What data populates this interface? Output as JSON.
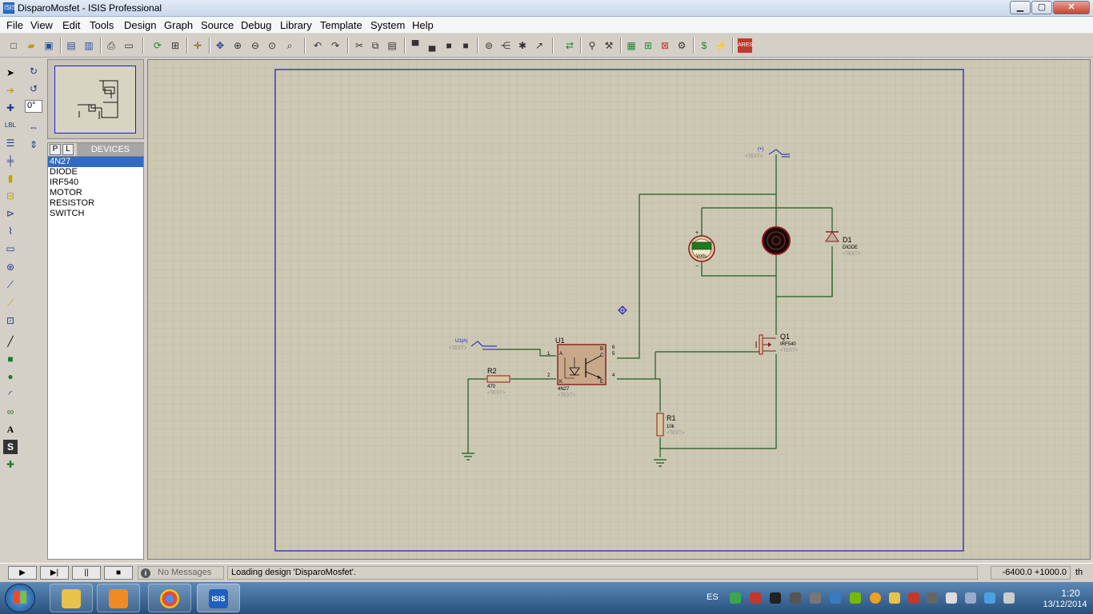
{
  "window": {
    "title": "DisparoMosfet - ISIS Professional",
    "app_icon_text": "ISIS",
    "min_label": "▁",
    "max_label": "▢",
    "close_label": "✕"
  },
  "menu": [
    "File",
    "View",
    "Edit",
    "Tools",
    "Design",
    "Graph",
    "Source",
    "Debug",
    "Library",
    "Template",
    "System",
    "Help"
  ],
  "side_panel": {
    "angle_value": "0°",
    "tab_p": "P",
    "tab_l": "L",
    "devices_title": "DEVICES",
    "devices": [
      "4N27",
      "DIODE",
      "IRF540",
      "MOTOR",
      "RESISTOR",
      "SWITCH"
    ],
    "selected_device": "4N27"
  },
  "schematic": {
    "source_label": "(+)",
    "source_text": "<TEXT>",
    "input_label": "U1(A)",
    "input_text": "<TEXT>",
    "u1_ref": "U1",
    "u1_part": "4N27",
    "u1_text": "<TEXT>",
    "u1_pins": {
      "a": "A",
      "k": "K",
      "b": "B",
      "c": "C",
      "e": "E",
      "p1": "1",
      "p2": "2",
      "p6": "6",
      "p5": "5",
      "p4": "4"
    },
    "r2_ref": "R2",
    "r2_value": "470",
    "r2_text": "<TEXT>",
    "r1_ref": "R1",
    "r1_value": "10k",
    "r1_text": "<TEXT>",
    "q1_ref": "Q1",
    "q1_part": "IRF540",
    "q1_text": "<TEXT>",
    "d1_ref": "D1",
    "d1_part": "DIODE",
    "d1_text": "<TEXT>",
    "voltmeter_label": "Volts",
    "voltmeter_plus": "+",
    "voltmeter_minus": "−"
  },
  "statusbar": {
    "play": "▶",
    "step": "▶|",
    "pause": "||",
    "stop": "■",
    "messages": "No Messages",
    "status": "Loading design 'DisparoMosfet'.",
    "coords": "-6400.0  +1000.0",
    "units": "th"
  },
  "taskbar": {
    "language": "ES",
    "time": "1:20",
    "date": "13/12/2014"
  }
}
